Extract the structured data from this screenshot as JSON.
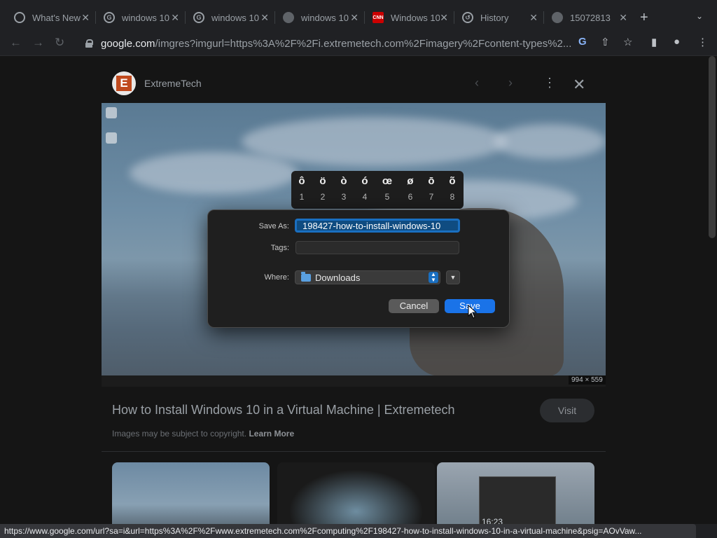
{
  "tabs": [
    {
      "title": "What's New",
      "favicon": "chrome-icon",
      "color": "#9aa0a6"
    },
    {
      "title": "windows 10",
      "favicon": "google-icon",
      "color": "#9aa0a6"
    },
    {
      "title": "windows 10",
      "favicon": "google-icon",
      "color": "#9aa0a6"
    },
    {
      "title": "windows 10",
      "favicon": "globe-icon",
      "color": "#9aa0a6"
    },
    {
      "title": "Windows 10",
      "favicon": "cnn-icon",
      "color": "#cc0000"
    },
    {
      "title": "History",
      "favicon": "history-icon",
      "color": "#9aa0a6"
    },
    {
      "title": "15072813",
      "favicon": "globe-icon",
      "color": "#9aa0a6"
    }
  ],
  "address": {
    "host": "google.com",
    "path": "/imgres?imgurl=https%3A%2F%2Fi.extremetech.com%2Fimagery%2Fcontent-types%2..."
  },
  "panel": {
    "logo_letter": "E",
    "site_name": "ExtremeTech",
    "image_dims": "994 × 559",
    "image_title": "How to Install Windows 10 in a Virtual Machine | Extremetech",
    "visit_label": "Visit",
    "copyright_text": "Images may be subject to copyright.",
    "learn_more": "Learn More",
    "thumb_clock": "16:23"
  },
  "accent_picker": {
    "items": [
      {
        "char": "ô",
        "num": "1"
      },
      {
        "char": "ö",
        "num": "2"
      },
      {
        "char": "ò",
        "num": "3"
      },
      {
        "char": "ó",
        "num": "4"
      },
      {
        "char": "œ",
        "num": "5"
      },
      {
        "char": "ø",
        "num": "6"
      },
      {
        "char": "ō",
        "num": "7"
      },
      {
        "char": "õ",
        "num": "8"
      }
    ]
  },
  "dialog": {
    "save_as_label": "Save As:",
    "save_as_value": "198427-how-to-install-windows-10",
    "tags_label": "Tags:",
    "tags_value": "",
    "where_label": "Where:",
    "where_value": "Downloads",
    "cancel_label": "Cancel",
    "save_label": "Save"
  },
  "status_url": "https://www.google.com/url?sa=i&url=https%3A%2F%2Fwww.extremetech.com%2Fcomputing%2F198427-how-to-install-windows-10-in-a-virtual-machine&psig=AOvVaw...",
  "colors": {
    "accent_blue": "#1a73e8",
    "extremetech_brand": "#c04a1e",
    "cnn_red": "#cc0000"
  }
}
